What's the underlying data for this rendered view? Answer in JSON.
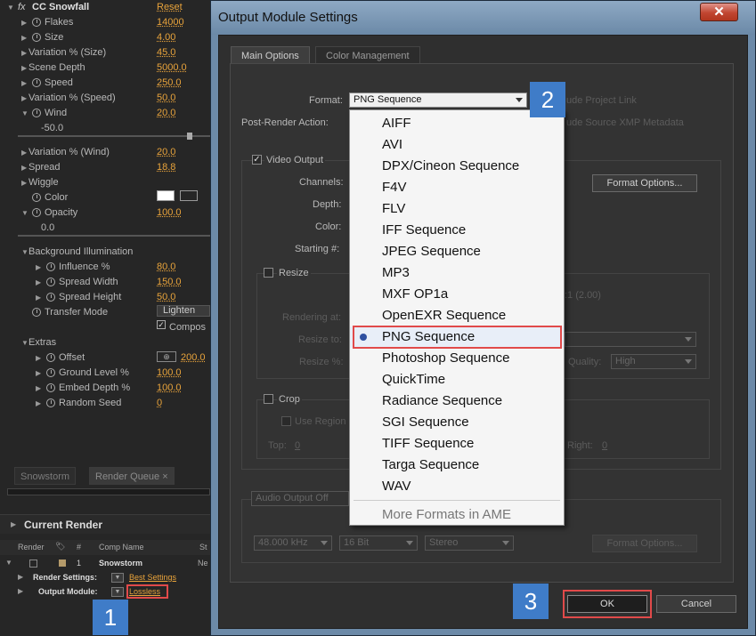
{
  "effect_panel": {
    "fx_label": "fx",
    "effect_name": "CC Snowfall",
    "reset_label": "Reset",
    "rows": [
      {
        "label": "Flakes",
        "value": "14000"
      },
      {
        "label": "Size",
        "value": "4.00"
      },
      {
        "label": "Variation % (Size)",
        "value": "45.0"
      },
      {
        "label": "Scene Depth",
        "value": "5000.0"
      },
      {
        "label": "Speed",
        "value": "250.0"
      },
      {
        "label": "Variation % (Speed)",
        "value": "50.0"
      },
      {
        "label": "Wind",
        "value": "20.0"
      },
      {
        "label": "-50.0",
        "value": ""
      },
      {
        "label": "Variation % (Wind)",
        "value": "20.0"
      },
      {
        "label": "Spread",
        "value": "18.8"
      },
      {
        "label": "Wiggle",
        "value": ""
      },
      {
        "label": "Color",
        "value": ""
      },
      {
        "label": "Opacity",
        "value": "100.0"
      },
      {
        "label": "0.0",
        "value": ""
      },
      {
        "label": "Background Illumination",
        "value": ""
      },
      {
        "label": "Influence %",
        "value": "80.0"
      },
      {
        "label": "Spread Width",
        "value": "150.0"
      },
      {
        "label": "Spread Height",
        "value": "50.0"
      },
      {
        "label": "Transfer Mode",
        "value": "Lighten"
      },
      {
        "label": "Compos",
        "value": ""
      },
      {
        "label": "Extras",
        "value": ""
      },
      {
        "label": "Offset",
        "value": "200.0"
      },
      {
        "label": "Ground Level %",
        "value": "100.0"
      },
      {
        "label": "Embed Depth %",
        "value": "100.0"
      },
      {
        "label": "Random Seed",
        "value": "0"
      }
    ]
  },
  "render_queue": {
    "tabs": [
      "Snowstorm",
      "Render Queue"
    ],
    "tab_close": "×",
    "current_render": "Current Render",
    "columns": [
      "Render",
      "#",
      "Comp Name",
      "St"
    ],
    "item": {
      "number": "1",
      "comp_name": "Snowstorm",
      "status": "Ne"
    },
    "render_settings_label": "Render Settings:",
    "render_settings_value": "Best Settings",
    "output_module_label": "Output Module:",
    "output_module_value": "Lossless"
  },
  "dialog": {
    "title": "Output Module Settings",
    "close": "✕",
    "tabs": [
      "Main Options",
      "Color Management"
    ],
    "format_label": "Format:",
    "format_value": "PNG Sequence",
    "post_render_label": "Post-Render Action:",
    "include_project_link": "ude Project Link",
    "include_xmp": "ude Source XMP Metadata",
    "video_output": "Video Output",
    "channels": "Channels:",
    "depth": "Depth:",
    "color": "Color:",
    "starting": "Starting #:",
    "format_options": "Format Options...",
    "resize": "Resize",
    "ratio": ":1 (2.00)",
    "rendering_at": "Rendering at:",
    "resize_to": "Resize to:",
    "resize_pct": "Resize %:",
    "quality_label": "Quality:",
    "quality_value": "High",
    "crop": "Crop",
    "use_region": "Use Region",
    "top": "Top:",
    "top_value": "0",
    "right": "Right:",
    "right_value": "0",
    "audio_output": "Audio Output Off",
    "audio_rate": "48.000 kHz",
    "audio_bits": "16 Bit",
    "audio_channels": "Stereo",
    "audio_format_options": "Format Options...",
    "ok": "OK",
    "cancel": "Cancel"
  },
  "format_menu": {
    "items": [
      "AIFF",
      "AVI",
      "DPX/Cineon Sequence",
      "F4V",
      "FLV",
      "IFF Sequence",
      "JPEG Sequence",
      "MP3",
      "MXF OP1a",
      "OpenEXR Sequence",
      "PNG Sequence",
      "Photoshop Sequence",
      "QuickTime",
      "Radiance Sequence",
      "SGI Sequence",
      "TIFF Sequence",
      "Targa Sequence",
      "WAV"
    ],
    "selected": "PNG Sequence",
    "more": "More Formats in AME"
  },
  "callouts": [
    "1",
    "2",
    "3"
  ]
}
